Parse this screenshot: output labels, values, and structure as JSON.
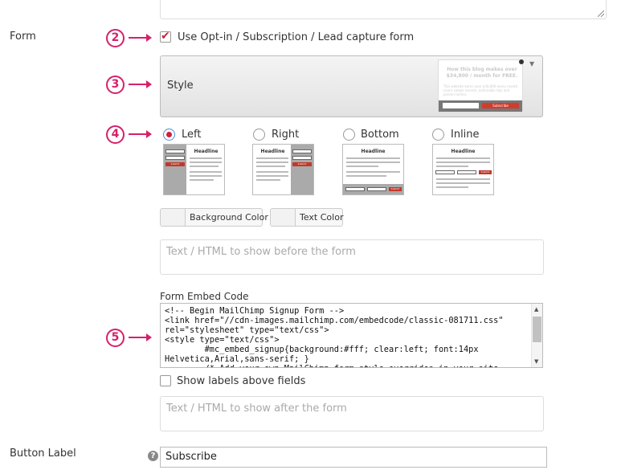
{
  "form": {
    "row_label": "Form",
    "use_optin": {
      "label": "Use Opt-in / Subscription / Lead capture form",
      "checked": true
    },
    "style_select": {
      "label": "Style",
      "thumb_headline": "How this blog makes over $34,800 / month for FREE.",
      "thumb_text": "This website earns over $34,800 every month. Learn simple secrets, actionable tips and proven tactics.",
      "thumb_button": "Subscribe"
    },
    "positions": [
      {
        "label": "Left",
        "selected": true
      },
      {
        "label": "Right",
        "selected": false
      },
      {
        "label": "Bottom",
        "selected": false
      },
      {
        "label": "Inline",
        "selected": false
      }
    ],
    "thumb_headline": "Headline",
    "thumb_submit": "Submit",
    "background_color_label": "Background Color",
    "text_color_label": "Text Color",
    "before_form_placeholder": "Text / HTML to show before the form",
    "embed_code_label": "Form Embed Code",
    "embed_code": "<!-- Begin MailChimp Signup Form -->\n<link href=\"//cdn-images.mailchimp.com/embedcode/classic-081711.css\"\nrel=\"stylesheet\" type=\"text/css\">\n<style type=\"text/css\">\n        #mc_embed_signup{background:#fff; clear:left; font:14px\nHelvetica,Arial,sans-serif; }\n        /* Add your own MailChimp form style overrides in your site",
    "show_labels": {
      "label": "Show labels above fields",
      "checked": false
    },
    "after_form_placeholder": "Text / HTML to show after the form"
  },
  "button": {
    "row_label": "Button Label",
    "help_glyph": "?",
    "value": "Subscribe"
  },
  "callouts": [
    "2",
    "3",
    "4",
    "5"
  ],
  "colors": {
    "accent": "#d6206b",
    "checkbox_red": "#d21f3c",
    "submit_red": "#c0392b"
  }
}
